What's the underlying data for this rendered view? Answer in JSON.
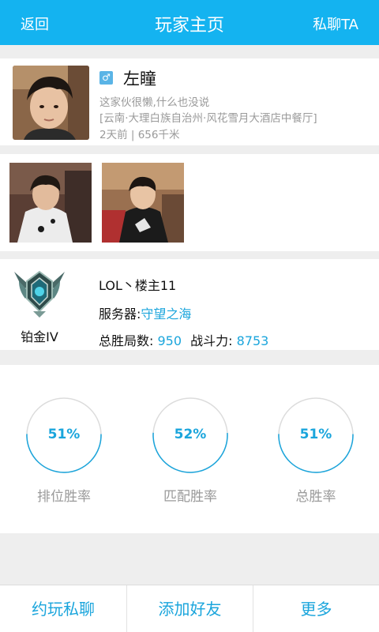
{
  "header": {
    "back_label": "返回",
    "title": "玩家主页",
    "private_chat_label": "私聊TA"
  },
  "profile": {
    "gender_symbol": "♂",
    "nickname": "左瞳",
    "signature": "这家伙很懒,什么也没说",
    "location": "[云南·大理白族自治州·风花雪月大酒店中餐厅]",
    "meta": "2天前 | 656千米",
    "gender_color": "#5ab4e6"
  },
  "photos": [
    {
      "name": "photo-1"
    },
    {
      "name": "photo-2"
    }
  ],
  "game": {
    "rank_icon": "platinum-emblem-icon",
    "rank_name": "铂金IV",
    "account": "LOL丶楼主11",
    "server_label": "服务器:",
    "server_value": "守望之海",
    "total_wins_label": "总胜局数:",
    "total_wins_value": "950",
    "power_label": "战斗力:",
    "power_value": "8753"
  },
  "stats": [
    {
      "label": "排位胜率",
      "value": "51%",
      "fraction": 0.51
    },
    {
      "label": "匹配胜率",
      "value": "52%",
      "fraction": 0.52
    },
    {
      "label": "总胜率",
      "value": "51%",
      "fraction": 0.51
    }
  ],
  "bottom": {
    "invite_label": "约玩私聊",
    "add_friend_label": "添加好友",
    "more_label": "更多"
  },
  "colors": {
    "accent": "#14b3f0",
    "link": "#1aa5dc",
    "muted": "#9a9a9a"
  }
}
